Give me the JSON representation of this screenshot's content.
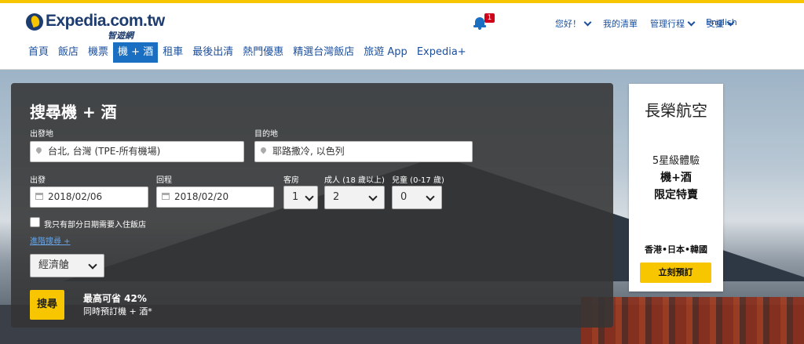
{
  "header": {
    "brand": "Expedia.com.tw",
    "brand_sub": "智遊網",
    "notification_count": "1",
    "util_nav": [
      "您好！",
      "我的清單",
      "管理行程",
      "支援"
    ],
    "language": "English"
  },
  "main_nav": {
    "tabs": [
      "首頁",
      "飯店",
      "機票",
      "機 + 酒",
      "租車",
      "最後出清",
      "熱門優惠",
      "精選台灣飯店",
      "旅遊 App",
      "Expedia+"
    ],
    "active_index": 3
  },
  "search": {
    "title": "搜尋機 + 酒",
    "origin_label": "出發地",
    "origin_value": "台北, 台灣 (TPE-所有機場)",
    "destination_label": "目的地",
    "destination_value": "耶路撒冷, 以色列",
    "depart_label": "出發",
    "depart_value": "2018/02/06",
    "return_label": "回程",
    "return_value": "2018/02/20",
    "rooms_label": "客房",
    "rooms_value": "1",
    "adults_label": "成人 (18 歲以上)",
    "adults_value": "2",
    "children_label": "兒童 (0-17 歲)",
    "children_value": "0",
    "partial_hotel_label": "我只有部分日期需要入住飯店",
    "advanced_link": "進階搜尋 +",
    "cabin_value": "經濟艙",
    "search_button": "搜尋",
    "savings_line1": "最高可省 42%",
    "savings_line2": "同時預訂機 + 酒*"
  },
  "ad": {
    "title": "長榮航空",
    "line1": "5星級體驗",
    "line2": "機+酒",
    "line3": "限定特賣",
    "destinations": "香港•日本•韓國",
    "button": "立刻預訂"
  }
}
